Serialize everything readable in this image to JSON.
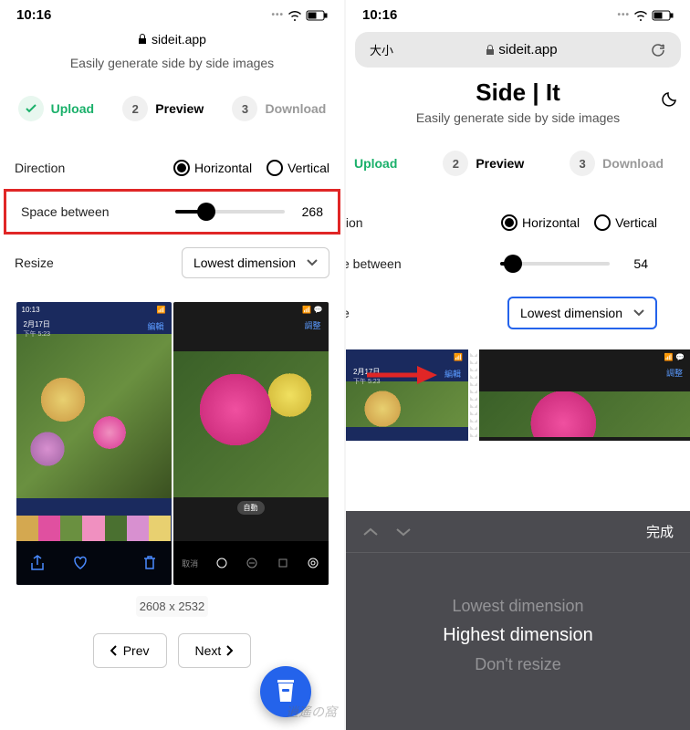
{
  "statusBar": {
    "time": "10:16"
  },
  "url": {
    "domain": "sideit.app",
    "sizeLabel": "大小"
  },
  "app": {
    "title": "Side | It",
    "subtitle": "Easily generate side by side images"
  },
  "steps": {
    "upload": "Upload",
    "previewNum": "2",
    "preview": "Preview",
    "downloadNum": "3",
    "download": "Download"
  },
  "form": {
    "directionLabel": "Direction",
    "horizontal": "Horizontal",
    "vertical": "Vertical",
    "spaceLabel": "Space between",
    "resizeLabel": "Resize",
    "resizeValue": "Lowest dimension"
  },
  "leftScreen": {
    "spaceValue": "268",
    "dimensions": "2608 x 2532"
  },
  "rightScreen": {
    "spaceValue": "54",
    "partialDirection": "tion",
    "partialSpace": "e between",
    "partialResize": "e"
  },
  "preview": {
    "phoneTime": "10:13",
    "phoneDate": "2月17日",
    "phoneTime2": "下午 5:23",
    "editBtn": "編輯",
    "adjustBtn": "調整",
    "cancelBtn": "取消",
    "auto": "自動"
  },
  "nav": {
    "prev": "Prev",
    "next": "Next"
  },
  "picker": {
    "done": "完成",
    "opt1": "Lowest dimension",
    "opt2": "Highest dimension",
    "opt3": "Don't resize"
  },
  "watermark": "逍遙の窩"
}
